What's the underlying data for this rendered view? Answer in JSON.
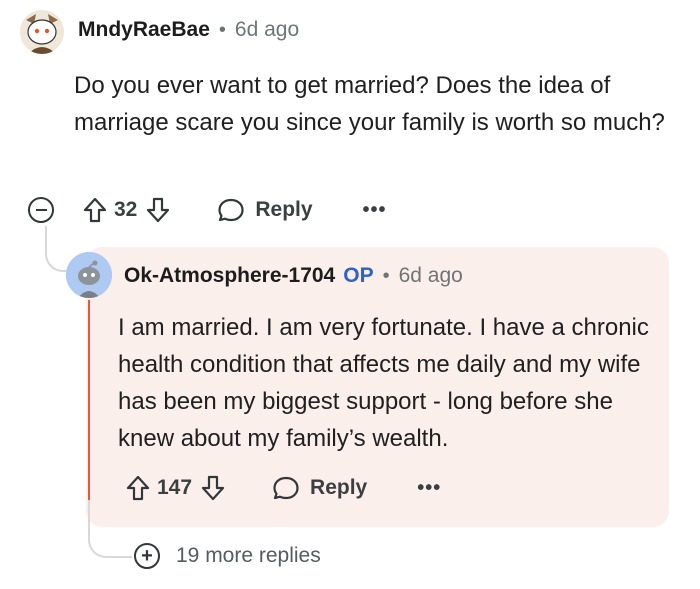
{
  "comment": {
    "username": "MndyRaeBae",
    "time": "6d ago",
    "body": "Do you ever want to get married? Does the idea of marriage scare you since your family is worth so much?",
    "score": "32",
    "reply_label": "Reply",
    "more_label": "•••"
  },
  "reply": {
    "username": "Ok-Atmosphere-1704",
    "op_badge": "OP",
    "time": "6d ago",
    "body": "I am married. I am very fortunate. I have a chronic health condition that affects me daily and my wife has been my biggest support - long before she knew about my family’s wealth.",
    "score": "147",
    "reply_label": "Reply",
    "more_label": "•••"
  },
  "more_replies": {
    "label": "19 more replies",
    "icon": "+"
  },
  "colors": {
    "reply_background": "#fbefec",
    "reply_accent": "#e05a3f",
    "op_badge": "#2e63c9"
  }
}
